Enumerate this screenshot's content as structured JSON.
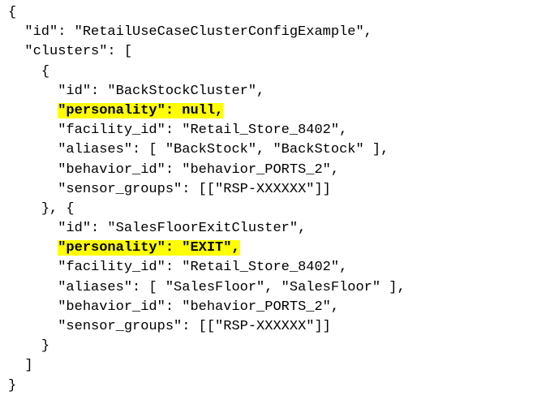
{
  "document": {
    "lines": [
      {
        "indent": "",
        "text": "{",
        "highlight": false
      },
      {
        "indent": "  ",
        "text": "\"id\": \"RetailUseCaseClusterConfigExample\",",
        "highlight": false
      },
      {
        "indent": "  ",
        "text": "\"clusters\": [",
        "highlight": false
      },
      {
        "indent": "    ",
        "text": "{",
        "highlight": false
      },
      {
        "indent": "      ",
        "text": "\"id\": \"BackStockCluster\",",
        "highlight": false
      },
      {
        "indent": "      ",
        "text": "\"personality\": null,",
        "highlight": true
      },
      {
        "indent": "      ",
        "text": "\"facility_id\": \"Retail_Store_8402\",",
        "highlight": false
      },
      {
        "indent": "      ",
        "text": "\"aliases\": [ \"BackStock\", \"BackStock\" ],",
        "highlight": false
      },
      {
        "indent": "      ",
        "text": "\"behavior_id\": \"behavior_PORTS_2\",",
        "highlight": false
      },
      {
        "indent": "      ",
        "text": "\"sensor_groups\": [[\"RSP-XXXXXX\"]]",
        "highlight": false
      },
      {
        "indent": "    ",
        "text": "}, {",
        "highlight": false
      },
      {
        "indent": "      ",
        "text": "\"id\": \"SalesFloorExitCluster\",",
        "highlight": false
      },
      {
        "indent": "      ",
        "text": "\"personality\": \"EXIT\",",
        "highlight": true
      },
      {
        "indent": "      ",
        "text": "\"facility_id\": \"Retail_Store_8402\",",
        "highlight": false
      },
      {
        "indent": "      ",
        "text": "\"aliases\": [ \"SalesFloor\", \"SalesFloor\" ],",
        "highlight": false
      },
      {
        "indent": "      ",
        "text": "\"behavior_id\": \"behavior_PORTS_2\",",
        "highlight": false
      },
      {
        "indent": "      ",
        "text": "\"sensor_groups\": [[\"RSP-XXXXXX\"]]",
        "highlight": false
      },
      {
        "indent": "    ",
        "text": "}",
        "highlight": false
      },
      {
        "indent": "  ",
        "text": "]",
        "highlight": false
      },
      {
        "indent": "",
        "text": "}",
        "highlight": false
      }
    ],
    "colors": {
      "background": "#ffffff",
      "text": "#000000",
      "highlight": "#ffff00"
    }
  }
}
